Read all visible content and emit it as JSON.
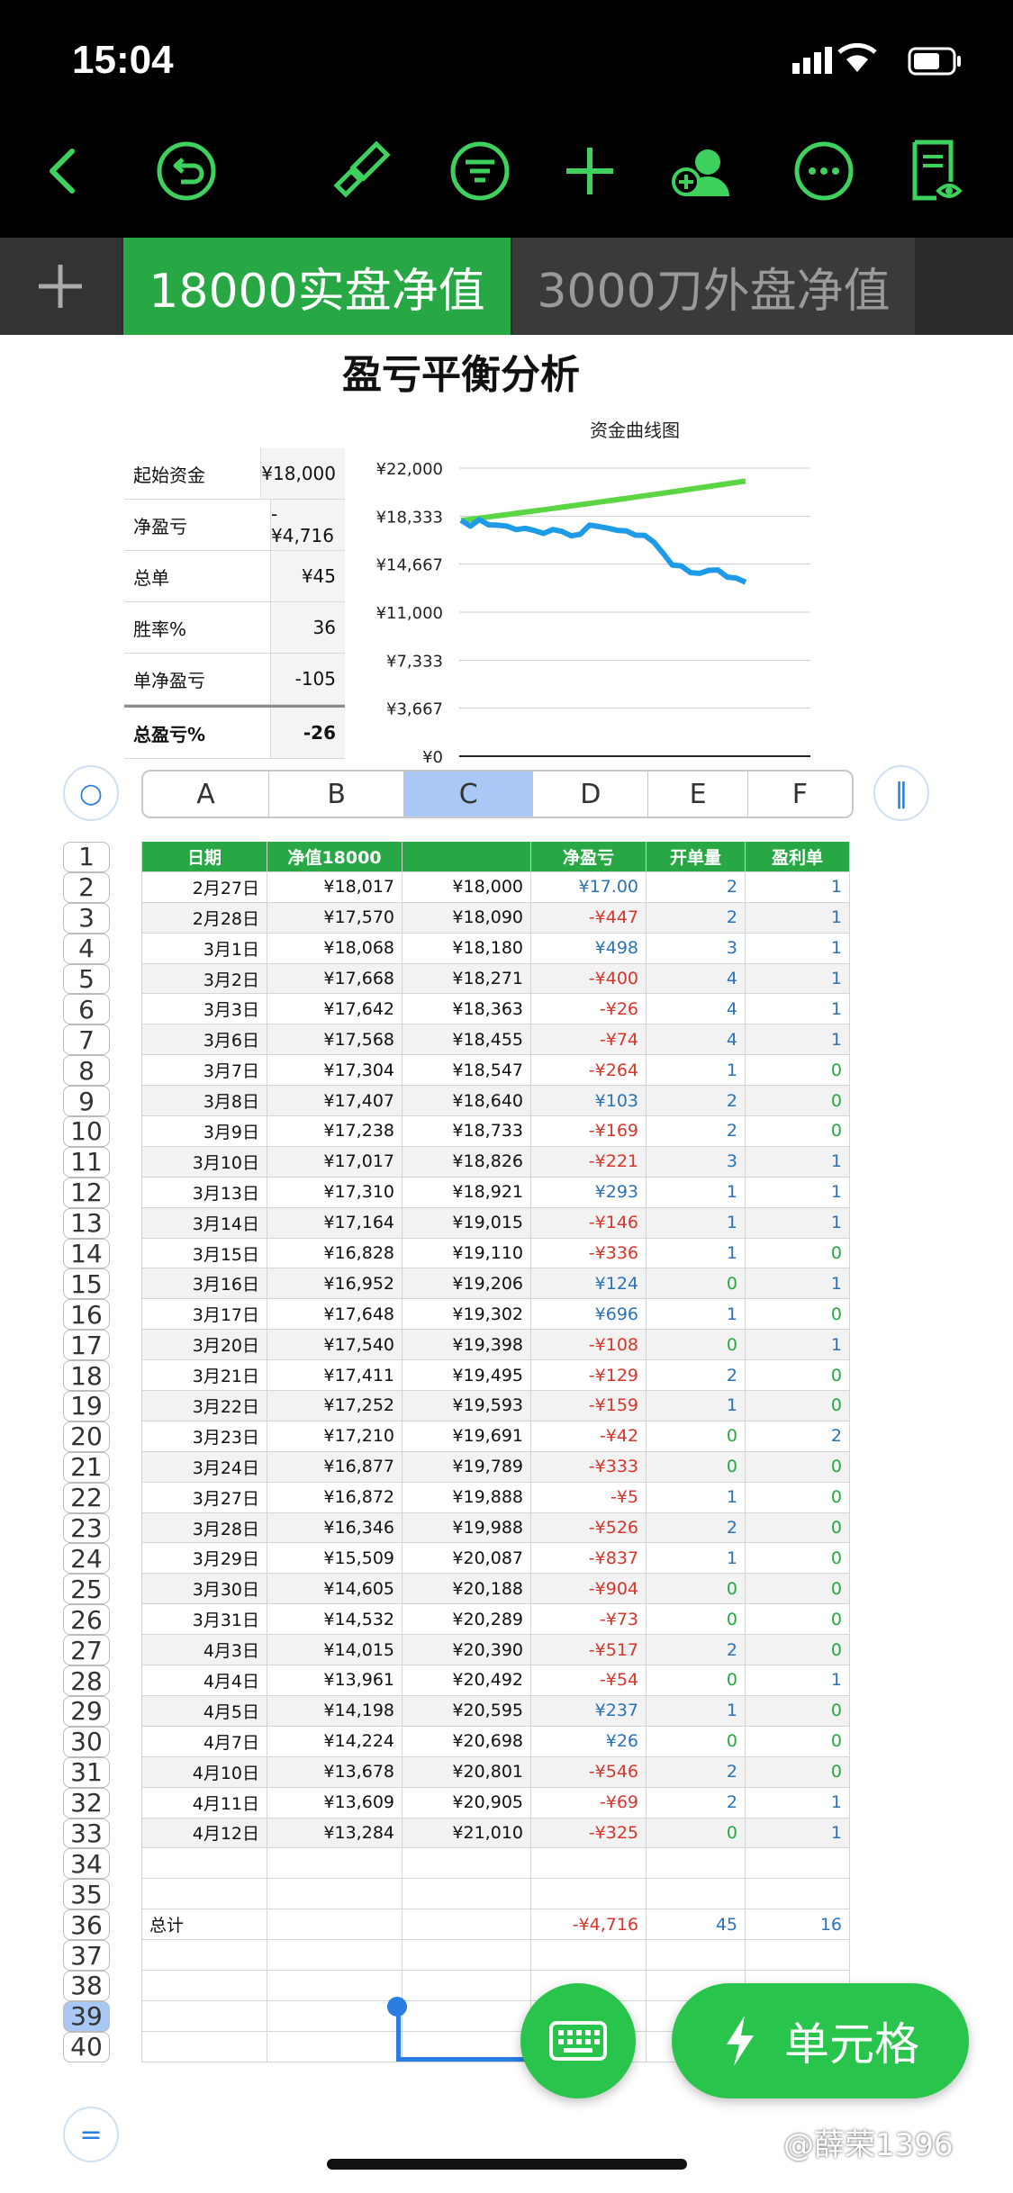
{
  "status": {
    "time": "15:04"
  },
  "toolbar": {
    "icons": [
      "back-icon",
      "undo-icon",
      "brush-icon",
      "filter-icon",
      "add-icon",
      "collaborate-icon",
      "more-icon",
      "document-view-icon"
    ]
  },
  "tabs": {
    "add": "+",
    "active": "18000实盘净值",
    "other": "3000刀外盘净值"
  },
  "analysis": {
    "title": "盈亏平衡分析",
    "summary": [
      {
        "label": "起始资金",
        "value": "¥18,000"
      },
      {
        "label": "净盈亏",
        "value": "-¥4,716"
      },
      {
        "label": "总单",
        "value": "¥45"
      },
      {
        "label": "胜率%",
        "value": "36"
      },
      {
        "label": "单净盈亏",
        "value": "-105"
      },
      {
        "label": "总盈亏%",
        "value": "-26"
      }
    ]
  },
  "chart_data": {
    "type": "line",
    "title": "资金曲线图",
    "ylim": [
      0,
      22000
    ],
    "yticks": [
      "¥22,000",
      "¥18,333",
      "¥14,667",
      "¥11,000",
      "¥7,333",
      "¥3,667",
      "¥0"
    ],
    "series": [
      {
        "color": "#5bd543",
        "values": [
          18000,
          18090,
          18180,
          18271,
          18363,
          18455,
          18547,
          18640,
          18733,
          18826,
          18921,
          19015,
          19110,
          19206,
          19302,
          19398,
          19495,
          19593,
          19691,
          19789,
          19888,
          19988,
          20087,
          20188,
          20289,
          20390,
          20492,
          20595,
          20698,
          20801,
          20905,
          21010
        ]
      },
      {
        "color": "#1e9be6",
        "values": [
          18017,
          17570,
          18068,
          17668,
          17642,
          17568,
          17304,
          17407,
          17238,
          17017,
          17310,
          17164,
          16828,
          16952,
          17648,
          17540,
          17411,
          17252,
          17210,
          16877,
          16872,
          16346,
          15509,
          14605,
          14532,
          14015,
          13961,
          14198,
          14224,
          13678,
          13609,
          13284
        ]
      }
    ]
  },
  "columns": [
    "A",
    "B",
    "C",
    "D",
    "E",
    "F"
  ],
  "selected_column": "C",
  "selected_row": "39",
  "header": [
    "日期",
    "净值18000",
    "",
    "净盈亏",
    "开单量",
    "盈利单"
  ],
  "rows": [
    [
      "2月27日",
      "¥18,017",
      "¥18,000",
      "¥17.00",
      "2",
      "1"
    ],
    [
      "2月28日",
      "¥17,570",
      "¥18,090",
      "-¥447",
      "2",
      "1"
    ],
    [
      "3月1日",
      "¥18,068",
      "¥18,180",
      "¥498",
      "3",
      "1"
    ],
    [
      "3月2日",
      "¥17,668",
      "¥18,271",
      "-¥400",
      "4",
      "1"
    ],
    [
      "3月3日",
      "¥17,642",
      "¥18,363",
      "-¥26",
      "4",
      "1"
    ],
    [
      "3月6日",
      "¥17,568",
      "¥18,455",
      "-¥74",
      "4",
      "1"
    ],
    [
      "3月7日",
      "¥17,304",
      "¥18,547",
      "-¥264",
      "1",
      "0"
    ],
    [
      "3月8日",
      "¥17,407",
      "¥18,640",
      "¥103",
      "2",
      "0"
    ],
    [
      "3月9日",
      "¥17,238",
      "¥18,733",
      "-¥169",
      "2",
      "0"
    ],
    [
      "3月10日",
      "¥17,017",
      "¥18,826",
      "-¥221",
      "3",
      "1"
    ],
    [
      "3月13日",
      "¥17,310",
      "¥18,921",
      "¥293",
      "1",
      "1"
    ],
    [
      "3月14日",
      "¥17,164",
      "¥19,015",
      "-¥146",
      "1",
      "1"
    ],
    [
      "3月15日",
      "¥16,828",
      "¥19,110",
      "-¥336",
      "1",
      "0"
    ],
    [
      "3月16日",
      "¥16,952",
      "¥19,206",
      "¥124",
      "0",
      "1"
    ],
    [
      "3月17日",
      "¥17,648",
      "¥19,302",
      "¥696",
      "1",
      "0"
    ],
    [
      "3月20日",
      "¥17,540",
      "¥19,398",
      "-¥108",
      "0",
      "1"
    ],
    [
      "3月21日",
      "¥17,411",
      "¥19,495",
      "-¥129",
      "2",
      "0"
    ],
    [
      "3月22日",
      "¥17,252",
      "¥19,593",
      "-¥159",
      "1",
      "0"
    ],
    [
      "3月23日",
      "¥17,210",
      "¥19,691",
      "-¥42",
      "0",
      "2"
    ],
    [
      "3月24日",
      "¥16,877",
      "¥19,789",
      "-¥333",
      "0",
      "0"
    ],
    [
      "3月27日",
      "¥16,872",
      "¥19,888",
      "-¥5",
      "1",
      "0"
    ],
    [
      "3月28日",
      "¥16,346",
      "¥19,988",
      "-¥526",
      "2",
      "0"
    ],
    [
      "3月29日",
      "¥15,509",
      "¥20,087",
      "-¥837",
      "1",
      "0"
    ],
    [
      "3月30日",
      "¥14,605",
      "¥20,188",
      "-¥904",
      "0",
      "0"
    ],
    [
      "3月31日",
      "¥14,532",
      "¥20,289",
      "-¥73",
      "0",
      "0"
    ],
    [
      "4月3日",
      "¥14,015",
      "¥20,390",
      "-¥517",
      "2",
      "0"
    ],
    [
      "4月4日",
      "¥13,961",
      "¥20,492",
      "-¥54",
      "0",
      "1"
    ],
    [
      "4月5日",
      "¥14,198",
      "¥20,595",
      "¥237",
      "1",
      "0"
    ],
    [
      "4月7日",
      "¥14,224",
      "¥20,698",
      "¥26",
      "0",
      "0"
    ],
    [
      "4月10日",
      "¥13,678",
      "¥20,801",
      "-¥546",
      "2",
      "0"
    ],
    [
      "4月11日",
      "¥13,609",
      "¥20,905",
      "-¥69",
      "2",
      "1"
    ],
    [
      "4月12日",
      "¥13,284",
      "¥21,010",
      "-¥325",
      "0",
      "1"
    ]
  ],
  "total_row": [
    "总计",
    "",
    "",
    "-¥4,716",
    "45",
    "16"
  ],
  "row_numbers": [
    "1",
    "2",
    "3",
    "4",
    "5",
    "6",
    "7",
    "8",
    "9",
    "10",
    "11",
    "12",
    "13",
    "14",
    "15",
    "16",
    "17",
    "18",
    "19",
    "20",
    "21",
    "22",
    "23",
    "24",
    "25",
    "26",
    "27",
    "28",
    "29",
    "30",
    "31",
    "32",
    "33",
    "34",
    "35",
    "36",
    "37",
    "38",
    "39",
    "40"
  ],
  "buttons": {
    "cell": "单元格"
  },
  "watermark": "@薛荣1396"
}
